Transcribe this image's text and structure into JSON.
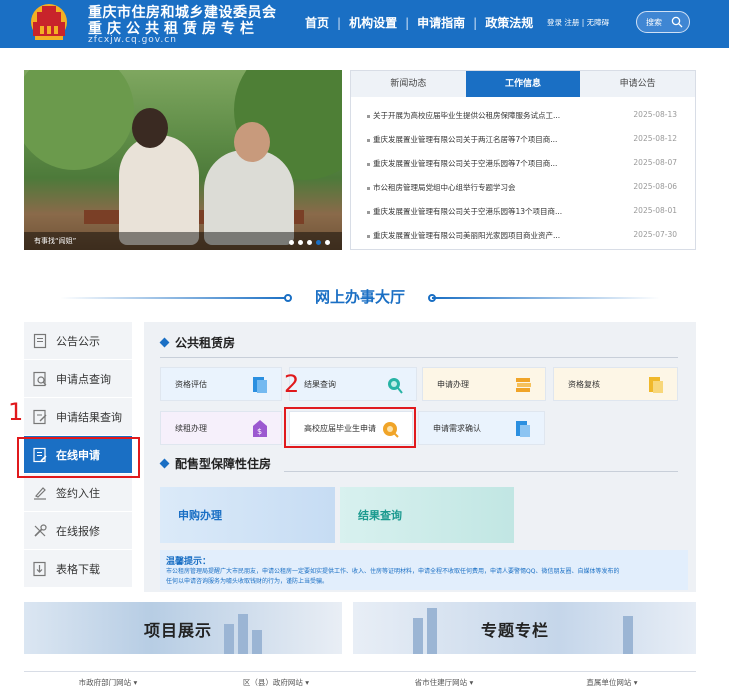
{
  "header": {
    "title_line1": "重庆市住房和城乡建设委员会",
    "title_line2": "重庆公共租赁房专栏",
    "domain": "zfcxjw.cq.gov.cn",
    "nav": [
      "首页",
      "机构设置",
      "申请指南",
      "政策法规"
    ],
    "toplinks": "登录 注册 | 无障碍",
    "search_label": "搜索"
  },
  "banner": {
    "caption": "有事找“阎姐”"
  },
  "news": {
    "tabs": [
      "新闻动态",
      "工作信息",
      "申请公告"
    ],
    "active_tab": "工作信息",
    "items": [
      {
        "title": "关于开展为高校应届毕业生提供公租房保障服务试点工...",
        "date": "2025-08-13"
      },
      {
        "title": "重庆发展置业管理有限公司关于两江名居等7个项目商...",
        "date": "2025-08-12"
      },
      {
        "title": "重庆发展置业管理有限公司关于空港乐园等7个项目商...",
        "date": "2025-08-07"
      },
      {
        "title": "市公租房管理局党组中心组举行专题学习会",
        "date": "2025-08-06"
      },
      {
        "title": "重庆发展置业管理有限公司关于空港乐园等13个项目商...",
        "date": "2025-08-01"
      },
      {
        "title": "重庆发展置业管理有限公司美丽阳光家园项目商业资产...",
        "date": "2025-07-30"
      }
    ]
  },
  "hall": {
    "title": "网上办事大厅"
  },
  "sidebar": {
    "items": [
      {
        "label": "公告公示",
        "icon": "notice-icon"
      },
      {
        "label": "申请点查询",
        "icon": "location-query-icon"
      },
      {
        "label": "申请结果查询",
        "icon": "result-query-icon"
      },
      {
        "label": "在线申请",
        "icon": "online-apply-icon"
      },
      {
        "label": "签约入住",
        "icon": "sign-contract-icon"
      },
      {
        "label": "在线报修",
        "icon": "repair-icon"
      },
      {
        "label": "表格下载",
        "icon": "download-icon"
      }
    ],
    "active_index": 3
  },
  "annotations": {
    "marker1": "1",
    "marker2": "2"
  },
  "public_rental": {
    "title": "公共租赁房",
    "services": [
      {
        "label": "资格评估",
        "icon": "assessment-icon",
        "color": "#2b8fe0"
      },
      {
        "label": "结果查询",
        "icon": "search-result-icon",
        "color": "#27b3a5"
      },
      {
        "label": "申请办理",
        "icon": "apply-process-icon",
        "color": "#f0a428"
      },
      {
        "label": "资格复核",
        "icon": "review-icon",
        "color": "#f0b82a"
      },
      {
        "label": "续租办理",
        "icon": "renew-icon",
        "color": "#9b59d0"
      },
      {
        "label": "高校应届毕业生申请",
        "icon": "graduate-apply-icon",
        "color": "#f0a428"
      },
      {
        "label": "申请需求确认",
        "icon": "confirm-need-icon",
        "color": "#2b8fe0"
      }
    ]
  },
  "sale_housing": {
    "title": "配售型保障性住房",
    "services": [
      {
        "label": "申购办理"
      },
      {
        "label": "结果查询"
      }
    ]
  },
  "notice": {
    "title": "温馨提示：",
    "body_line1": "市公租房管理局提醒广大市民朋友，申请公租房一定要如实提供工作、收入、住房等证明材料，申请全程不收取任何费用，申请人要警惕QQ、微信朋友圈、自媒体等发布的",
    "body_line2": "任何以申请咨询服务为噱头收取钱财的行为，谨防上当受骗。"
  },
  "bottom_banners": {
    "left": "项目展示",
    "right": "专题专栏"
  },
  "footer": {
    "links": [
      "市政府部门网站",
      "区（县）政府网站",
      "省市住建厅网站",
      "直属单位网站"
    ]
  },
  "colors": {
    "primary": "#1a6fc4",
    "highlight_red": "#e0191c"
  }
}
